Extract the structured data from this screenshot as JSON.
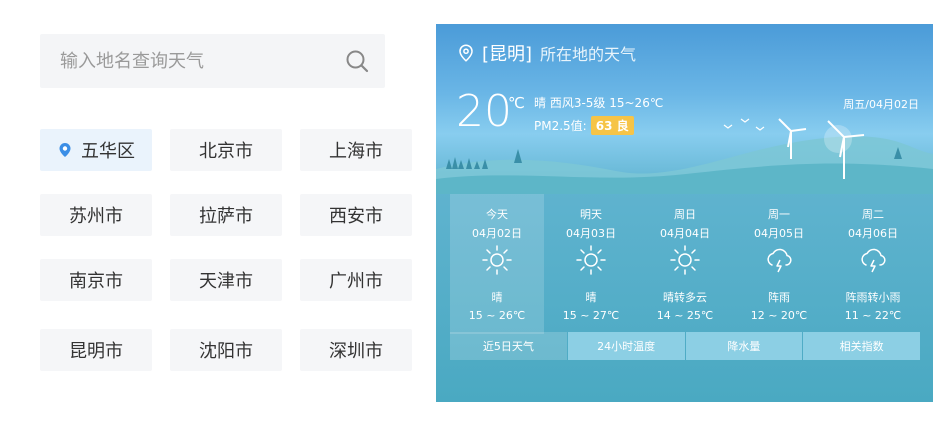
{
  "search": {
    "placeholder": "输入地名查询天气",
    "icon": "search-icon"
  },
  "cities": [
    {
      "label": "五华区",
      "active": true
    },
    {
      "label": "北京市"
    },
    {
      "label": "上海市"
    },
    {
      "label": "苏州市"
    },
    {
      "label": "拉萨市"
    },
    {
      "label": "西安市"
    },
    {
      "label": "南京市"
    },
    {
      "label": "天津市"
    },
    {
      "label": "广州市"
    },
    {
      "label": "昆明市"
    },
    {
      "label": "沈阳市"
    },
    {
      "label": "深圳市"
    }
  ],
  "weather": {
    "city": "[昆明]",
    "city_suffix": "所在地的天气",
    "temp": "20",
    "unit": "℃",
    "condition_line": "晴  西风3-5级  15~26℃",
    "pm_label": "PM2.5值:",
    "aqi": "63 良",
    "date": "周五/04月02日",
    "days": [
      {
        "name": "今天",
        "date": "04月02日",
        "cond": "晴",
        "range": "15 ~ 26℃",
        "icon": "sun-icon"
      },
      {
        "name": "明天",
        "date": "04月03日",
        "cond": "晴",
        "range": "15 ~ 27℃",
        "icon": "sun-icon"
      },
      {
        "name": "周日",
        "date": "04月04日",
        "cond": "晴转多云",
        "range": "14 ~ 25℃",
        "icon": "sun-icon"
      },
      {
        "name": "周一",
        "date": "04月05日",
        "cond": "阵雨",
        "range": "12 ~ 20℃",
        "icon": "thunder-rain-icon"
      },
      {
        "name": "周二",
        "date": "04月06日",
        "cond": "阵雨转小雨",
        "range": "11 ~ 22℃",
        "icon": "thunder-rain-icon"
      }
    ],
    "tabs": [
      "近5日天气",
      "24小时温度",
      "降水量",
      "相关指数"
    ]
  },
  "colors": {
    "accent": "#4a90e2",
    "aqi": "#f6c447",
    "card_top": "#4b9bd8"
  }
}
